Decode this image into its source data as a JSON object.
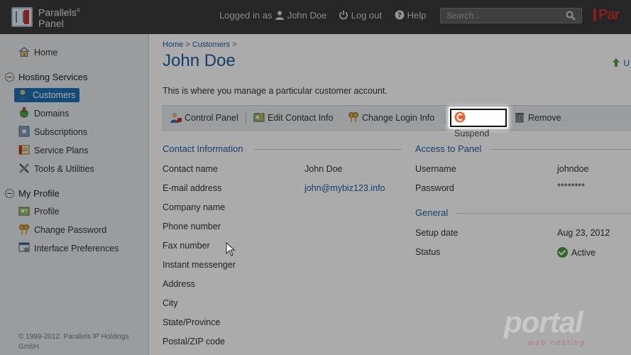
{
  "header": {
    "logo_line1": "Parallels",
    "logo_reg": "®",
    "logo_line2": "Panel",
    "logged_in_label": "Logged in as",
    "user_name": "John Doe",
    "logout_label": "Log out",
    "help_label": "Help",
    "search_placeholder": "Search...",
    "brand_fragment": "Par"
  },
  "sidebar": {
    "home": "Home",
    "sections": [
      {
        "title": "Hosting Services",
        "items": [
          "Customers",
          "Domains",
          "Subscriptions",
          "Service Plans",
          "Tools & Utilities"
        ]
      },
      {
        "title": "My Profile",
        "items": [
          "Profile",
          "Change Password",
          "Interface Preferences"
        ]
      }
    ],
    "active_item": "Customers",
    "copyright": "© 1999-2012. Parallels IP Holdings GmbH."
  },
  "main": {
    "breadcrumb": [
      "Home",
      "Customers"
    ],
    "breadcrumb_sep": ">",
    "title": "John Doe",
    "update_fragment": "U",
    "description": "This is where you manage a particular customer account.",
    "toolbar": {
      "control_panel": "Control Panel",
      "edit_contact": "Edit Contact Info",
      "change_login": "Change Login Info",
      "suspend": "Suspend",
      "remove": "Remove"
    },
    "contact": {
      "title": "Contact Information",
      "fields": [
        {
          "label": "Contact name",
          "value": "John Doe"
        },
        {
          "label": "E-mail address",
          "value": "john@mybiz123.info"
        },
        {
          "label": "Company name",
          "value": ""
        },
        {
          "label": "Phone number",
          "value": ""
        },
        {
          "label": "Fax number",
          "value": ""
        },
        {
          "label": "Instant messenger",
          "value": ""
        },
        {
          "label": "Address",
          "value": ""
        },
        {
          "label": "City",
          "value": ""
        },
        {
          "label": "State/Province",
          "value": ""
        },
        {
          "label": "Postal/ZIP code",
          "value": ""
        }
      ]
    },
    "access": {
      "title": "Access to Panel",
      "username_label": "Username",
      "username_value": "johndoe",
      "password_label": "Password",
      "password_value": "********"
    },
    "general": {
      "title": "General",
      "setup_label": "Setup date",
      "setup_value": "Aug 23, 2012",
      "status_label": "Status",
      "status_value": "Active"
    }
  },
  "watermark": {
    "main": "portal",
    "sub": "web hosting"
  },
  "colors": {
    "accent": "#1f5f9f",
    "active_nav": "#1f6fb2",
    "status_ok": "#4a9a3a",
    "suspend": "#e8632c"
  }
}
